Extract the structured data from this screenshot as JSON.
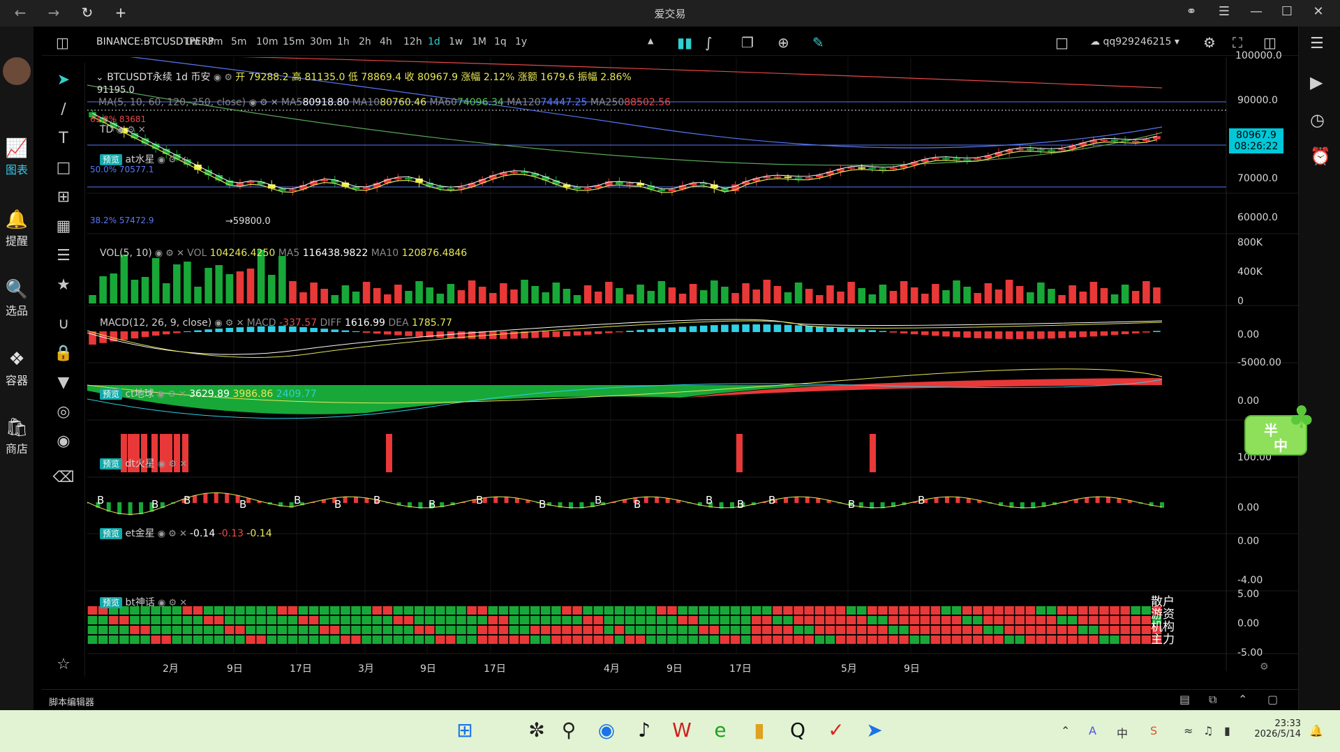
{
  "window": {
    "title": "爱交易"
  },
  "appbar": {
    "items": [
      {
        "label": "图表",
        "icon": "chart-icon"
      },
      {
        "label": "提醒",
        "icon": "bell-icon"
      },
      {
        "label": "选品",
        "icon": "magnifier-chart-icon"
      },
      {
        "label": "容器",
        "icon": "diamond-arrows-icon"
      },
      {
        "label": "商店",
        "icon": "bag-icon"
      }
    ]
  },
  "toolbar": {
    "symbol": "BINANCE:BTCUSDTPERP",
    "timeframes": [
      "1m",
      "3m",
      "5m",
      "10m",
      "15m",
      "30m",
      "1h",
      "2h",
      "4h",
      "12h",
      "1d",
      "1w",
      "1M",
      "1q",
      "1y"
    ],
    "active_timeframe": "1d",
    "account": "qq929246215"
  },
  "main_legend": {
    "title": "BTCUSDT永续 1d 币安",
    "open_label": "开",
    "open": "79288.2",
    "high_label": "高",
    "high": "81135.0",
    "low_label": "低",
    "low": "78869.4",
    "close_label": "收",
    "close": "80967.9",
    "chg_pct_label": "涨幅",
    "chg_pct": "2.12%",
    "chg_label": "涨额",
    "chg": "1679.6",
    "amp_label": "振幅",
    "amp": "2.86%"
  },
  "ma_legend": {
    "name": "MA(5, 10, 60, 120, 250, close)",
    "ma5_label": "MA5",
    "ma5": "80918.80",
    "ma10_label": "MA10",
    "ma10": "80760.46",
    "ma60_label": "MA60",
    "ma60": "74096.34",
    "ma120_label": "MA120",
    "ma120": "74447.25",
    "ma250_label": "MA250",
    "ma250": "88502.56"
  },
  "td_legend": "TD",
  "preview_label": "预览",
  "at_legend": "at水星",
  "fib": {
    "top": "91195.0",
    "l618": "61.8% 83681",
    "l50": "50.0% 70577.1",
    "l382": "38.2% 57472.9",
    "low": "59800.0"
  },
  "price_axis": {
    "ticks": [
      "100000.0",
      "90000.0",
      "70000.0",
      "60000.0"
    ],
    "last": "80967.9",
    "countdown": "08:26:22"
  },
  "vol": {
    "name": "VOL(5, 10)",
    "vol_label": "VOL",
    "vol": "104246.4250",
    "ma5_label": "MA5",
    "ma5": "116438.9822",
    "ma10_label": "MA10",
    "ma10": "120876.4846",
    "ticks": [
      "800K",
      "400K",
      "0"
    ]
  },
  "macd": {
    "name": "MACD(12, 26, 9, close)",
    "macd_label": "MACD",
    "macd": "-337.57",
    "diff_label": "DIFF",
    "diff": "1616.99",
    "dea_label": "DEA",
    "dea": "1785.77",
    "ticks": [
      "0.00",
      "-5000.00"
    ]
  },
  "ct": {
    "name": "ct地球",
    "v1": "3629.89",
    "v2": "3986.86",
    "v3": "2409.77",
    "ticks": [
      "0.00"
    ]
  },
  "dt": {
    "name": "dt火星",
    "ticks": [
      "100.00",
      "0.00"
    ]
  },
  "et": {
    "name": "et金星",
    "v1": "-0.14",
    "v2": "-0.13",
    "v3": "-0.14",
    "ticks": [
      "0.00",
      "-4.00"
    ]
  },
  "bt": {
    "name": "bt神话",
    "ticks": [
      "5.00",
      "0.00",
      "-5.00"
    ],
    "row_labels": [
      "散户",
      "游资",
      "机构",
      "主力"
    ]
  },
  "x_axis": [
    "2月",
    "9日",
    "17日",
    "3月",
    "9日",
    "17日",
    "4月",
    "9日",
    "17日",
    "5月",
    "9日"
  ],
  "editor": {
    "label": "脚本编辑器"
  },
  "widget": {
    "text1": "半",
    "text2": "中"
  },
  "taskbar": {
    "time": "23:33",
    "date": "2026/5/14"
  },
  "colors": {
    "up": "#e83838",
    "down": "#18a838",
    "accent": "#30d0d0",
    "td_buy": "#30d8d8",
    "td_sell": "#e83838"
  }
}
